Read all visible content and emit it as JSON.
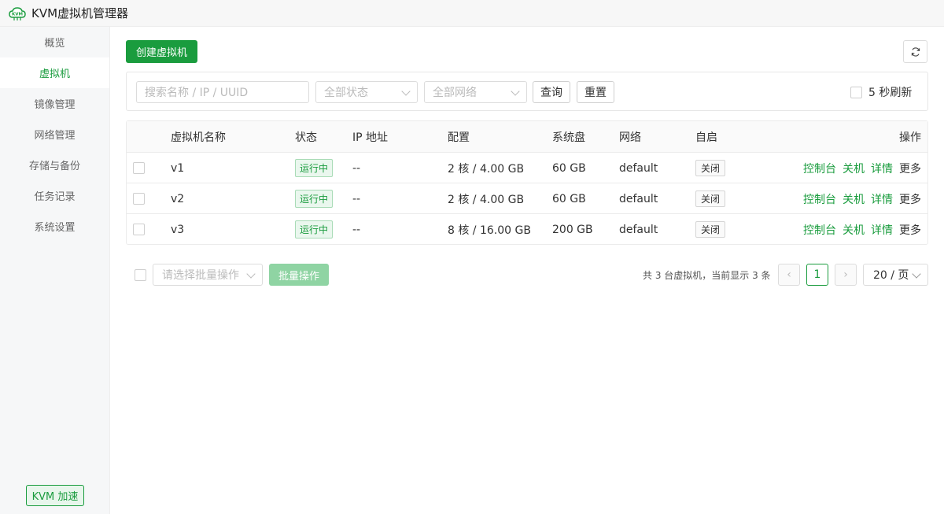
{
  "app": {
    "title": "KVM虚拟机管理器",
    "logo_text": "KVM"
  },
  "sidebar": {
    "items": [
      {
        "label": "概览",
        "active": false
      },
      {
        "label": "虚拟机",
        "active": true
      },
      {
        "label": "镜像管理",
        "active": false
      },
      {
        "label": "网络管理",
        "active": false
      },
      {
        "label": "存储与备份",
        "active": false
      },
      {
        "label": "任务记录",
        "active": false
      },
      {
        "label": "系统设置",
        "active": false
      }
    ],
    "badge": "KVM 加速"
  },
  "toolbar": {
    "create_label": "创建虚拟机",
    "refresh_icon": "refresh-icon"
  },
  "filters": {
    "search_placeholder": "搜索名称 / IP / UUID",
    "status_placeholder": "全部状态",
    "network_placeholder": "全部网络",
    "query_label": "查询",
    "reset_label": "重置",
    "auto_refresh_label": "5 秒刷新"
  },
  "table": {
    "columns": [
      "虚拟机名称",
      "状态",
      "IP 地址",
      "配置",
      "系统盘",
      "网络",
      "自启",
      "操作"
    ],
    "rows": [
      {
        "name": "v1",
        "status": "运行中",
        "ip": "--",
        "config": "2 核 / 4.00 GB",
        "disk": "60 GB",
        "network": "default",
        "autostart": "关闭",
        "actions": [
          "控制台",
          "关机",
          "详情",
          "更多"
        ]
      },
      {
        "name": "v2",
        "status": "运行中",
        "ip": "--",
        "config": "2 核 / 4.00 GB",
        "disk": "60 GB",
        "network": "default",
        "autostart": "关闭",
        "actions": [
          "控制台",
          "关机",
          "详情",
          "更多"
        ]
      },
      {
        "name": "v3",
        "status": "运行中",
        "ip": "--",
        "config": "8 核 / 16.00 GB",
        "disk": "200 GB",
        "network": "default",
        "autostart": "关闭",
        "actions": [
          "控制台",
          "关机",
          "详情",
          "更多"
        ]
      }
    ]
  },
  "footer": {
    "batch_placeholder": "请选择批量操作",
    "batch_button": "批量操作",
    "total_text": "共 3 台虚拟机，当前显示 3 条",
    "prev": "‹",
    "next": "›",
    "current_page": "1",
    "page_size": "20 / 页"
  },
  "colors": {
    "accent": "#1a9c3e",
    "accent_light": "#8fd4a3"
  }
}
